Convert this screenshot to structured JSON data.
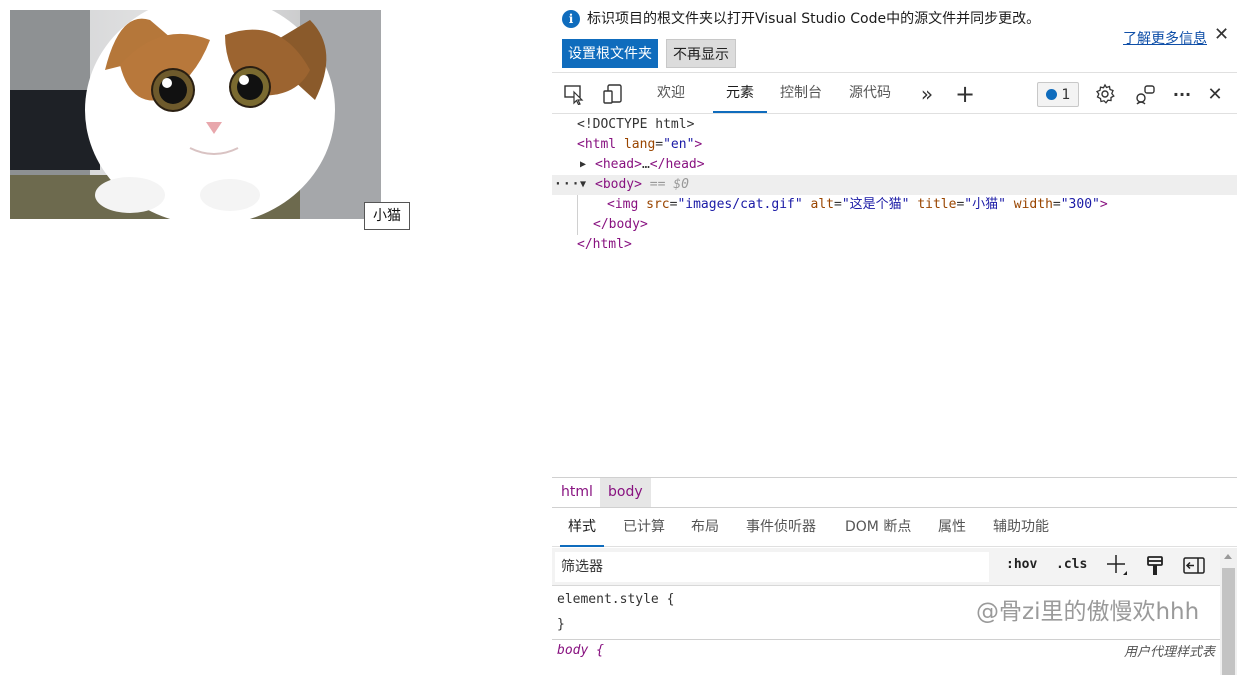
{
  "page": {
    "image": {
      "icon": "cat-photo",
      "subject": "cat"
    },
    "tooltip": "小猫"
  },
  "devtools": {
    "infobar": {
      "message": "标识项目的根文件夹以打开Visual Studio Code中的源文件并同步更改。",
      "link": "了解更多信息",
      "primary_button": "设置根文件夹",
      "secondary_button": "不再显示",
      "close": "✕"
    },
    "toolbar": {
      "tabs": [
        "欢迎",
        "元素",
        "控制台",
        "源代码"
      ],
      "active_tab": "元素",
      "more_tabs": "»",
      "add_tab": "+",
      "issues_count": "1",
      "more_menu": "···",
      "close": "✕"
    },
    "dom": {
      "doctype": "<!DOCTYPE html>",
      "html_open": {
        "tag": "html",
        "attr": "lang",
        "value": "\"en\""
      },
      "head": {
        "open": "<head>",
        "ellipsis": "…",
        "close": "</head>"
      },
      "body": {
        "open": "<body>",
        "marker": "== $0",
        "dots": "···"
      },
      "img": {
        "tag": "img",
        "attrs": [
          {
            "name": "src",
            "value": "\"images/cat.gif\""
          },
          {
            "name": "alt",
            "value": "\"这是个猫\""
          },
          {
            "name": "title",
            "value": "\"小猫\""
          },
          {
            "name": "width",
            "value": "\"300\""
          }
        ]
      },
      "body_close": "</body>",
      "html_close": "</html>"
    },
    "breadcrumbs": [
      "html",
      "body"
    ],
    "subtabs": [
      "样式",
      "已计算",
      "布局",
      "事件侦听器",
      "DOM 断点",
      "属性",
      "辅助功能"
    ],
    "active_subtab": "样式",
    "filter": {
      "placeholder": "筛选器",
      "hov": ":hov",
      "cls": ".cls"
    },
    "styles": {
      "element_style_open": "element.style {",
      "close_brace": "}",
      "body_selector": "body",
      "body_open_brace": "{",
      "ua_label": "用户代理样式表"
    },
    "watermark": "@骨zi里的傲慢欢hhh",
    "colors": {
      "accent": "#0f6cbd",
      "tag": "#881280",
      "attr_name": "#994500",
      "attr_value": "#1a1aa6"
    }
  }
}
